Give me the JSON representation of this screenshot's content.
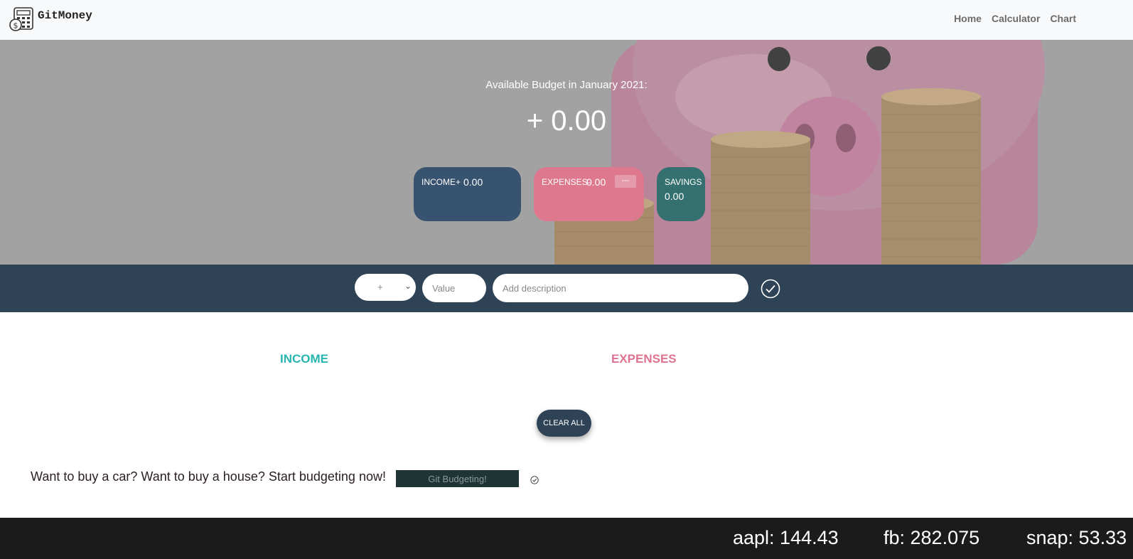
{
  "navbar": {
    "brand": "GitMoney",
    "brand_icon": "calculator-money-icon",
    "links": [
      "Home",
      "Calculator",
      "Chart"
    ]
  },
  "hero": {
    "budget_title": "Available Budget in January 2021:",
    "budget_value": "+ 0.00",
    "income": {
      "label": "INCOME",
      "sign": "+",
      "value": "0.00"
    },
    "expenses": {
      "label": "EXPENSES",
      "sign": "-",
      "value": "0.00",
      "percentage": "---"
    },
    "savings": {
      "label": "SAVINGS",
      "value": "0.00"
    }
  },
  "input_bar": {
    "type_selected": "+",
    "value_placeholder": "Value",
    "description_placeholder": "Add description"
  },
  "lists": {
    "income_title": "INCOME",
    "expenses_title": "EXPENSES",
    "clear_label": "CLEAR ALL"
  },
  "promo": {
    "text": "Want to buy a car? Want to buy a house? Start budgeting now!",
    "button_label": "Git Budgeting!"
  },
  "ticker": [
    {
      "symbol": "aapl",
      "price": "144.43",
      "text": "aapl: 144.43"
    },
    {
      "symbol": "fb",
      "price": "282.075",
      "text": "fb: 282.075"
    },
    {
      "symbol": "snap",
      "price": "53.33",
      "text": "snap: 53.33"
    }
  ],
  "colors": {
    "navbar_bg": "#f8f9fa",
    "income_card": "#38536f",
    "expenses_card": "#dd788f",
    "savings_card": "#357070",
    "input_bar": "#2f4356",
    "income_title": "#27b5b0",
    "expenses_title": "#dd7390",
    "ticker_bg": "#1b1b1b"
  }
}
